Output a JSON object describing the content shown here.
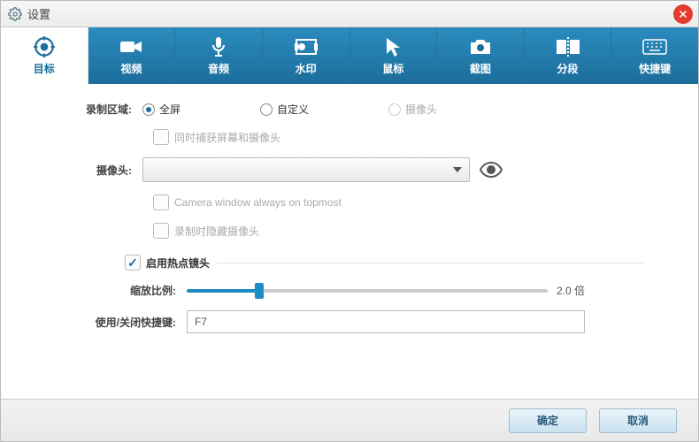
{
  "window": {
    "title": "设置"
  },
  "tabs": [
    {
      "id": "target",
      "label": "目标",
      "icon": "target"
    },
    {
      "id": "video",
      "label": "视频",
      "icon": "camcorder"
    },
    {
      "id": "audio",
      "label": "音频",
      "icon": "microphone"
    },
    {
      "id": "watermark",
      "label": "水印",
      "icon": "frame"
    },
    {
      "id": "mouse",
      "label": "鼠标",
      "icon": "cursor"
    },
    {
      "id": "snapshot",
      "label": "截图",
      "icon": "camera"
    },
    {
      "id": "segment",
      "label": "分段",
      "icon": "split"
    },
    {
      "id": "hotkey",
      "label": "快捷键",
      "icon": "keyboard"
    }
  ],
  "area": {
    "label": "录制区域:",
    "options": {
      "fullscreen": "全屏",
      "custom": "自定义",
      "camera": "摄像头"
    },
    "capture_both": "同时捕获屏幕和摄像头"
  },
  "camera": {
    "label": "摄像头:",
    "selected": "",
    "always_top": "Camera window always on topmost",
    "hide_when_rec": "录制时隐藏摄像头"
  },
  "hotspot": {
    "enable": "启用热点镜头",
    "zoom_label": "缩放比例:",
    "zoom_value": "2.0 倍",
    "hotkey_label": "使用/关闭快捷键:",
    "hotkey_value": "F7"
  },
  "buttons": {
    "ok": "确定",
    "cancel": "取消"
  }
}
